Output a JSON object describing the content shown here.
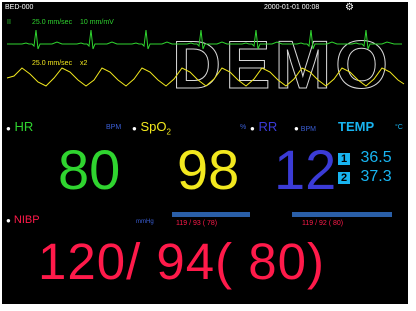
{
  "header": {
    "device": "BED-000",
    "datetime": "2000-01-01  00:08",
    "status_icon": "gear-icon"
  },
  "waveforms": {
    "ecg_label": "II",
    "ecg_speed": "25.0 mm/sec",
    "ecg_gain": "10 mm/mV",
    "spo2_speed": "25.0 mm/sec",
    "spo2_gain": "x2",
    "watermark": "DEMO"
  },
  "hr": {
    "label": "HR",
    "unit": "BPM",
    "value": "80"
  },
  "spo2": {
    "label": "SpO",
    "label_sub": "2",
    "unit": "%",
    "value": "98"
  },
  "rr": {
    "label": "RR",
    "unit": "BPM",
    "value": "12"
  },
  "temp": {
    "label": "TEMP",
    "unit": "°C",
    "ch1": "1",
    "ch1_value": "36.5",
    "ch2": "2",
    "ch2_value": "37.3"
  },
  "nibp": {
    "label": "NIBP",
    "unit": "mmHg",
    "prev1": "119 / 93 ( 78)",
    "prev2": "119 / 92 ( 80)",
    "value": "120/  94(  80)"
  },
  "colors": {
    "hr": "#2fd42f",
    "spo2": "#f2e81e",
    "rr": "#3b3bd6",
    "temp": "#18b4f0",
    "nibp": "#ff1a4a"
  }
}
